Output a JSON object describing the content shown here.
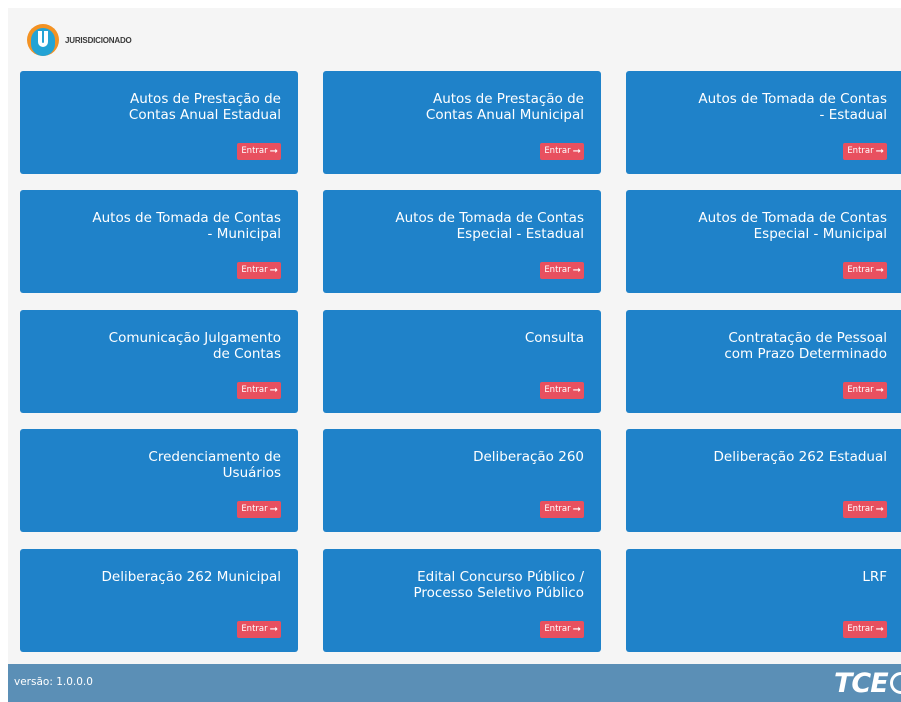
{
  "header": {
    "logo_text": "JURISDICIONADO"
  },
  "cards": [
    {
      "title": "Autos de Prestação de\nContas Anual Estadual",
      "button": "Entrar"
    },
    {
      "title": "Autos de Prestação de\nContas Anual Municipal",
      "button": "Entrar"
    },
    {
      "title": "Autos de Tomada de Contas\n- Estadual",
      "button": "Entrar"
    },
    {
      "title": "Autos de Tomada de Contas\n- Municipal",
      "button": "Entrar"
    },
    {
      "title": "Autos de Tomada de Contas\nEspecial - Estadual",
      "button": "Entrar"
    },
    {
      "title": "Autos de Tomada de Contas\nEspecial - Municipal",
      "button": "Entrar"
    },
    {
      "title": "Comunicação Julgamento\nde Contas",
      "button": "Entrar"
    },
    {
      "title": "Consulta",
      "button": "Entrar"
    },
    {
      "title": "Contratação de Pessoal\ncom Prazo Determinado",
      "button": "Entrar"
    },
    {
      "title": "Credenciamento de\nUsuários",
      "button": "Entrar"
    },
    {
      "title": "Deliberação 260",
      "button": "Entrar"
    },
    {
      "title": "Deliberação 262 Estadual",
      "button": "Entrar"
    },
    {
      "title": "Deliberação 262 Municipal",
      "button": "Entrar"
    },
    {
      "title": "Edital Concurso Público /\nProcesso Seletivo Público",
      "button": "Entrar"
    },
    {
      "title": "LRF",
      "button": "Entrar"
    }
  ],
  "icons": {
    "enter_arrow": "arrow-right-icon",
    "logo": "jurisdicionado-logo-icon"
  },
  "colors": {
    "card": "#1f82c9",
    "button": "#e8505f",
    "footer": "#5b8fb6",
    "background": "#f5f5f5"
  },
  "footer": {
    "version": "versão: 1.0.0.0",
    "brand": "TCE"
  }
}
